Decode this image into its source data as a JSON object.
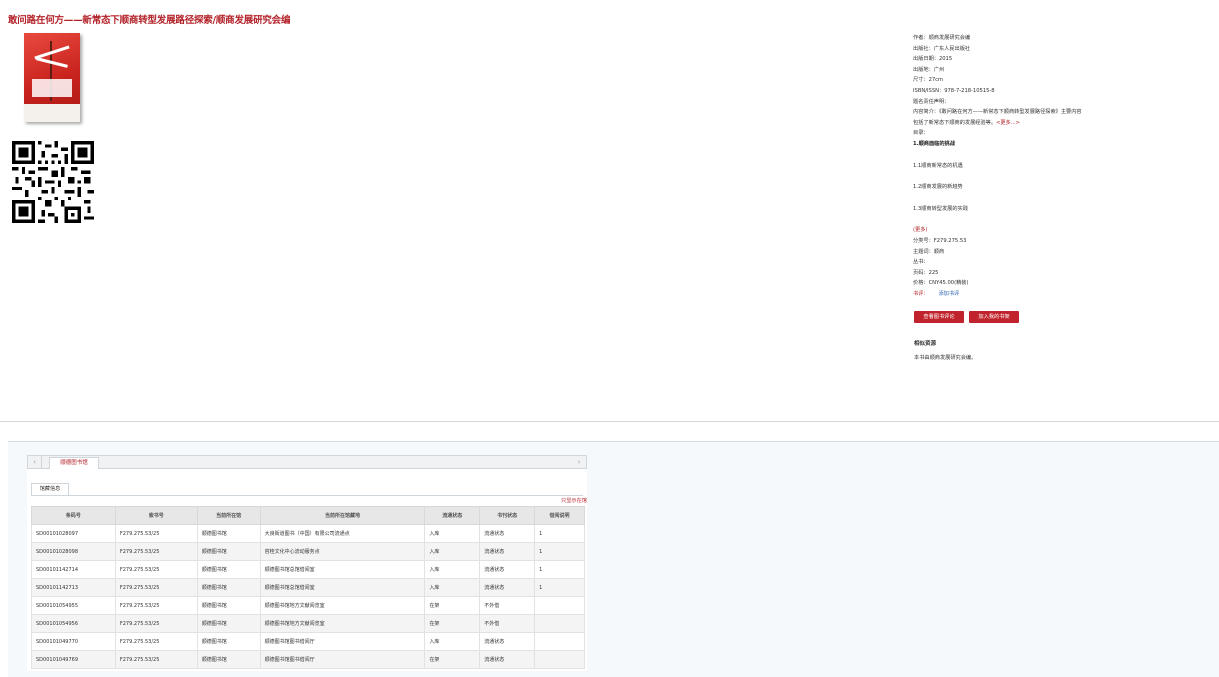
{
  "page_title": "敢问路在何方——新常态下顺商转型发展路径探索/顺商发展研究会编",
  "meta": {
    "author": "作者：顺商发展研究会编",
    "publisher": "出版社：广东人民出版社",
    "pub_date": "出版日期：2015",
    "pub_place": "出版地：广州",
    "size": "尺寸：27cm",
    "isbn": "ISBN/ISSN：978-7-218-10515-8",
    "title_note": "题名责任声明：",
    "summary_1": "内容简介：《敢问路在何方——新常态下顺商转型发展路径探索》主要内容",
    "summary_2": "包括了新常态下顺商的发展经验等。",
    "more_link": "<更多...>",
    "toc_label": "目录：",
    "toc_1": "1.顺商面临的挑战",
    "toc_2": "1.1顺商新常态的机遇",
    "toc_3": "1.2顺商发展的新趋势",
    "toc_4": "1.3顺商转型发展的实践",
    "toc_more": "(更多)",
    "class_no": "分类号：F279.275.53",
    "subject": "主题词：顺商",
    "series": "丛书：",
    "pages": "页码：225",
    "price": "价格：CNY45.00(精装)",
    "book_review_label": "书评：",
    "book_review_link": "添加书评"
  },
  "buttons": {
    "view_reviews": "查看图书评论",
    "add_shelf": "加入我的书架"
  },
  "related": {
    "title": "相似资源",
    "text": "本书由顺商发展研究会编。"
  },
  "tabs": {
    "main": "顺德图书馆",
    "sub": "馆藏信息",
    "only_available": "只显示在馆"
  },
  "table": {
    "headers": [
      "条码号",
      "索书号",
      "当前所在馆",
      "当前所在馆藏地",
      "流通状态",
      "书刊状态",
      "借阅说明"
    ],
    "rows": [
      [
        "SD00101028097",
        "F279.275.53/25",
        "顺德图书馆",
        "大良街道图书（中国）有限公司流通点",
        "入库",
        "流通状态",
        "1"
      ],
      [
        "SD00101028098",
        "F279.275.53/25",
        "顺德图书馆",
        "容桂文化中心流动服务点",
        "入库",
        "流通状态",
        "1"
      ],
      [
        "SD00101142714",
        "F279.275.53/25",
        "顺德图书馆",
        "顺德图书馆总馆借阅室",
        "入库",
        "流通状态",
        "1"
      ],
      [
        "SD00101142713",
        "F279.275.53/25",
        "顺德图书馆",
        "顺德图书馆总馆借阅室",
        "入库",
        "流通状态",
        "1"
      ],
      [
        "SD00101054955",
        "F279.275.53/25",
        "顺德图书馆",
        "顺德图书馆地方文献阅览室",
        "在架",
        "不外借",
        ""
      ],
      [
        "SD00101054956",
        "F279.275.53/25",
        "顺德图书馆",
        "顺德图书馆地方文献阅览室",
        "在架",
        "不外借",
        ""
      ],
      [
        "SD00101049770",
        "F279.275.53/25",
        "顺德图书馆",
        "顺德图书馆图书借阅厅",
        "入库",
        "流通状态",
        ""
      ],
      [
        "SD00101049769",
        "F279.275.53/25",
        "顺德图书馆",
        "顺德图书馆图书借阅厅",
        "在架",
        "流通状态",
        ""
      ]
    ]
  }
}
